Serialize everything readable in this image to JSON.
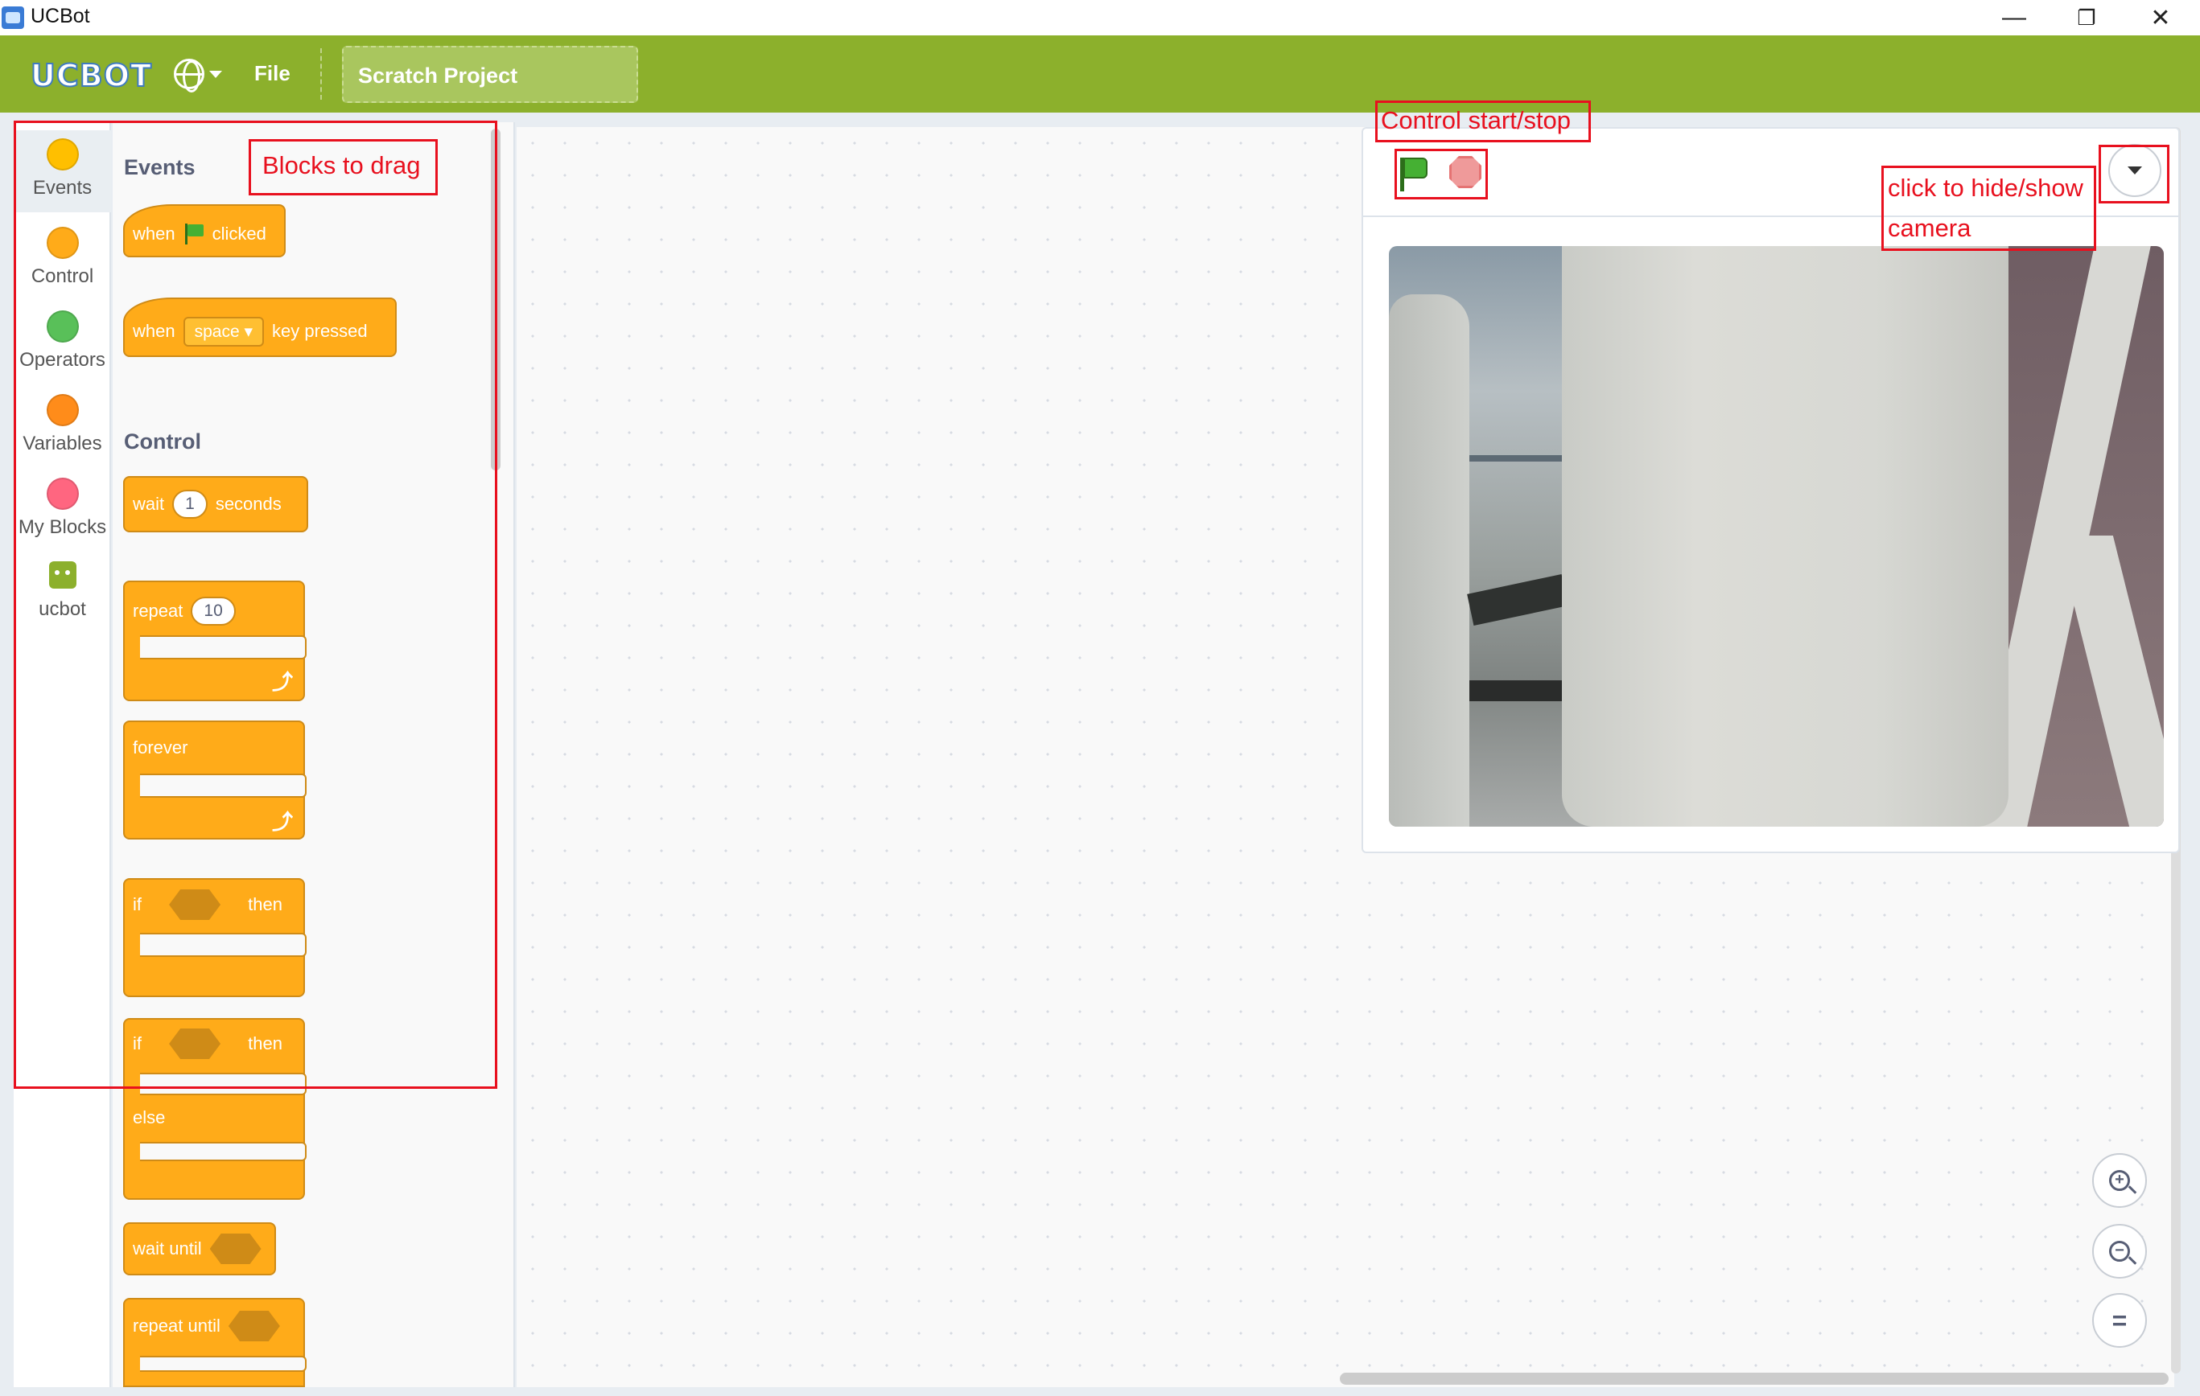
{
  "window": {
    "title": "UCBot",
    "controls": {
      "minimize": "—",
      "restore": "❐",
      "close": "✕"
    }
  },
  "menubar": {
    "logo_text": "UCBOT",
    "file_label": "File",
    "project_title": "Scratch Project"
  },
  "categories": [
    {
      "label": "Events",
      "color": "#ffbf00"
    },
    {
      "label": "Control",
      "color": "#ffab19"
    },
    {
      "label": "Operators",
      "color": "#59c059"
    },
    {
      "label": "Variables",
      "color": "#ff8c1a"
    },
    {
      "label": "My Blocks",
      "color": "#ff6680"
    },
    {
      "label": "ucbot",
      "color": "#8cb02c"
    }
  ],
  "palette": {
    "events_title": "Events",
    "control_title": "Control",
    "when_flag": {
      "when": "when",
      "clicked": "clicked"
    },
    "when_key": {
      "when": "when",
      "key": "space",
      "pressed": "key pressed"
    },
    "wait": {
      "label": "wait",
      "value": "1",
      "unit": "seconds"
    },
    "repeat": {
      "label": "repeat",
      "value": "10"
    },
    "forever": "forever",
    "if_then": {
      "if": "if",
      "then": "then"
    },
    "if_else": {
      "if": "if",
      "then": "then",
      "else": "else"
    },
    "wait_until": "wait until",
    "repeat_until": "repeat until"
  },
  "annotations": {
    "blocks": "Blocks to drag",
    "control": "Control start/stop",
    "camera_line1": "click to hide/show",
    "camera_line2": "camera"
  },
  "zoom": {
    "in": "+",
    "out": "−",
    "reset": "="
  }
}
